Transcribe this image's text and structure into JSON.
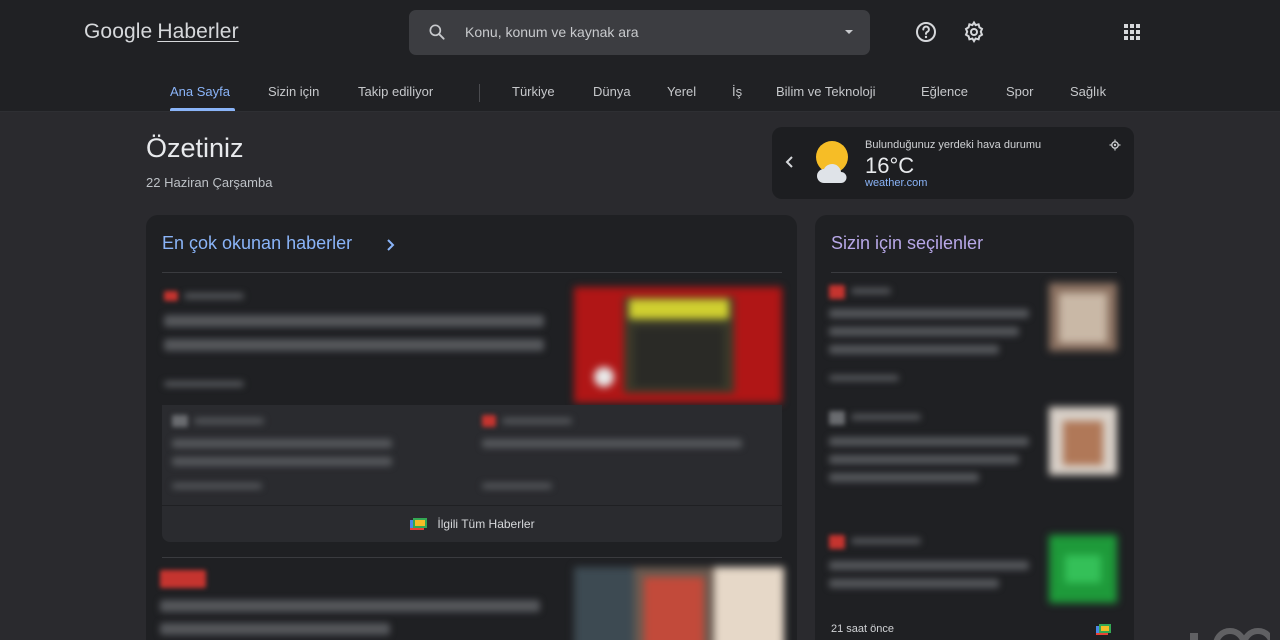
{
  "header": {
    "logo_google": "Google",
    "logo_news": "Haberler",
    "search_placeholder": "Konu, konum ve kaynak ara",
    "icons": [
      "search-icon",
      "chevron-down-icon",
      "help-icon",
      "gear-icon",
      "apps-grid-icon"
    ]
  },
  "nav": {
    "tabs": [
      {
        "label": "Ana Sayfa",
        "active": true
      },
      {
        "label": "Sizin için"
      },
      {
        "label": "Takip ediliyor"
      },
      {
        "label": "Türkiye"
      },
      {
        "label": "Dünya"
      },
      {
        "label": "Yerel"
      },
      {
        "label": "İş"
      },
      {
        "label": "Bilim ve Teknoloji"
      },
      {
        "label": "Eğlence"
      },
      {
        "label": "Spor"
      },
      {
        "label": "Sağlık"
      }
    ]
  },
  "summary": {
    "title": "Özetiniz",
    "date": "22 Haziran Çarşamba"
  },
  "weather": {
    "caption": "Bulunduğunuz yerdeki hava durumu",
    "temperature": "16°C",
    "source": "weather.com",
    "icon": "partly-cloudy-icon"
  },
  "top_stories": {
    "title": "En çok okunan haberler",
    "related_label": "İlgili Tüm Haberler"
  },
  "for_you": {
    "title": "Sizin için seçilenler",
    "time": "21 saat önce"
  },
  "colors": {
    "accent": "#8ab4f8",
    "for_you_title": "#b8a8e8",
    "background": "#2a2a2e",
    "header": "#202124",
    "panel": "#1f2023"
  }
}
